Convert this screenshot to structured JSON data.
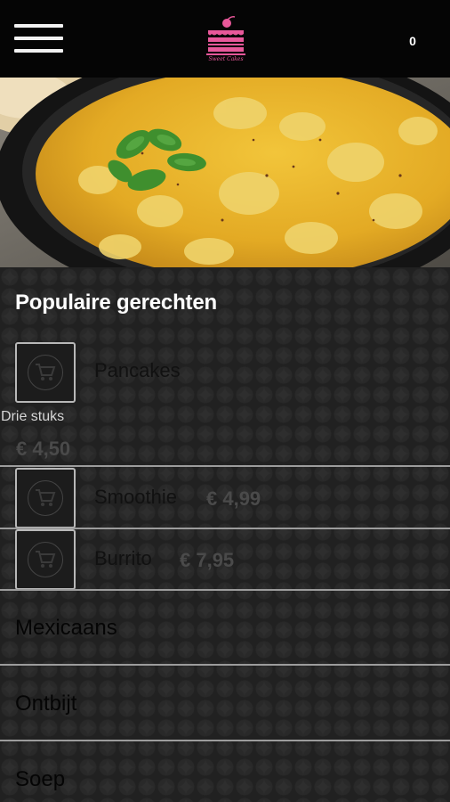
{
  "header": {
    "menu_icon": "hamburger-menu-icon",
    "logo_icon": "cake-logo-icon",
    "logo_text": "Sweet Cakes",
    "cart_count": "0",
    "colors": {
      "background": "#050505",
      "brand": "#e8589a"
    }
  },
  "hero": {
    "image": "curry-dish-photo"
  },
  "popular": {
    "title": "Populaire gerechten",
    "items": [
      {
        "name": "Pancakes",
        "description": "Drie stuks",
        "price": "€ 4,50",
        "icon": "shopping-cart-icon"
      },
      {
        "name": "Smoothie",
        "price": "€ 4,99",
        "icon": "shopping-cart-icon"
      },
      {
        "name": "Burrito",
        "price": "€ 7,95",
        "icon": "shopping-cart-icon"
      }
    ]
  },
  "categories": [
    {
      "label": "Mexicaans"
    },
    {
      "label": "Ontbijt"
    },
    {
      "label": "Soep"
    }
  ]
}
